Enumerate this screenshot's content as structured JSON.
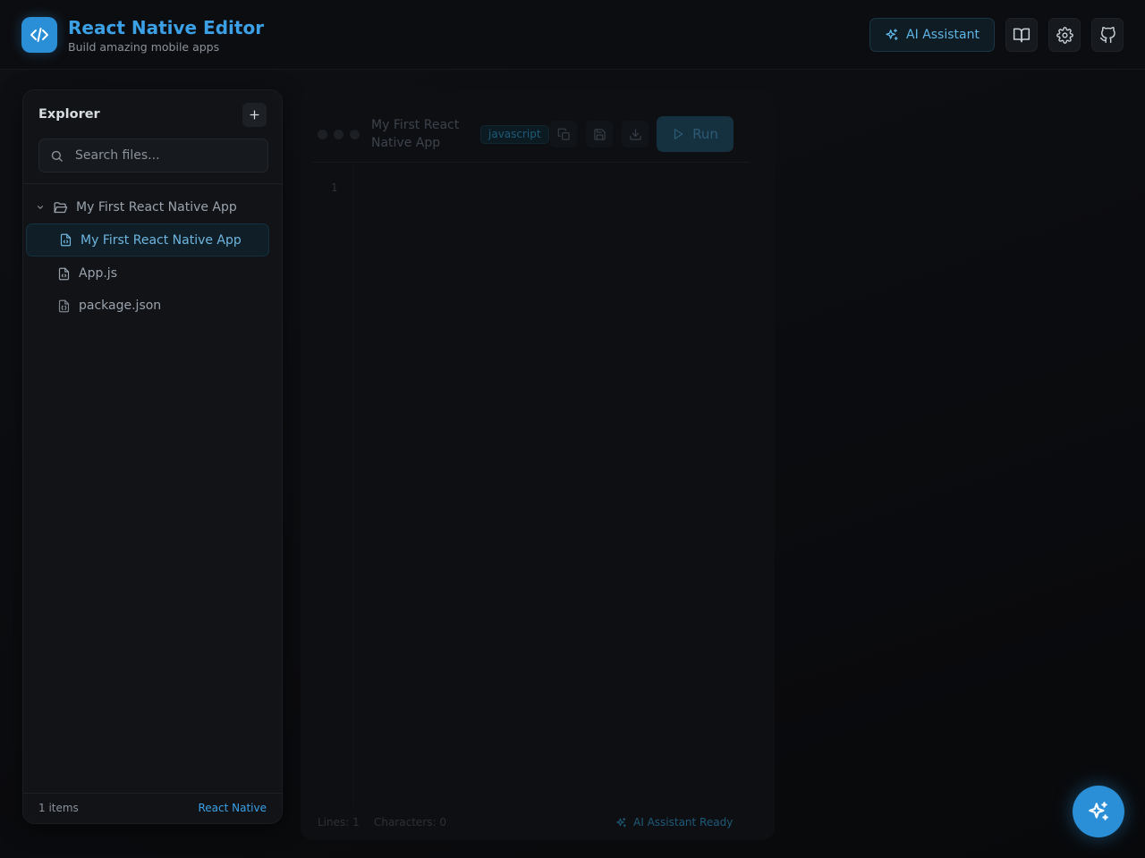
{
  "header": {
    "title": "React Native Editor",
    "subtitle": "Build amazing mobile apps",
    "ai_button_label": "AI Assistant",
    "icons": [
      "code-icon",
      "sparkles-icon",
      "book-icon",
      "gear-icon",
      "github-icon"
    ]
  },
  "explorer": {
    "title": "Explorer",
    "search_placeholder": "Search files...",
    "folder": {
      "name": "My First React Native App",
      "expanded": true
    },
    "files": [
      {
        "name": "My First React Native App",
        "icon": "file-code-icon",
        "active": true
      },
      {
        "name": "App.js",
        "icon": "file-code-icon",
        "active": false
      },
      {
        "name": "package.json",
        "icon": "file-json-icon",
        "active": false
      }
    ],
    "footer": {
      "items_count": "1 items",
      "framework": "React Native"
    }
  },
  "editor": {
    "file_name": "My First React Native App",
    "language": "javascript",
    "run_label": "Run",
    "line_number": "1",
    "lines_label": "Lines: 1",
    "characters_label": "Characters: 0",
    "ai_status": "AI Assistant Ready"
  },
  "colors": {
    "accent": "#2a8fd6",
    "title": "#3ba0e6",
    "background": "#0b0c0f",
    "panel": "#111317"
  }
}
